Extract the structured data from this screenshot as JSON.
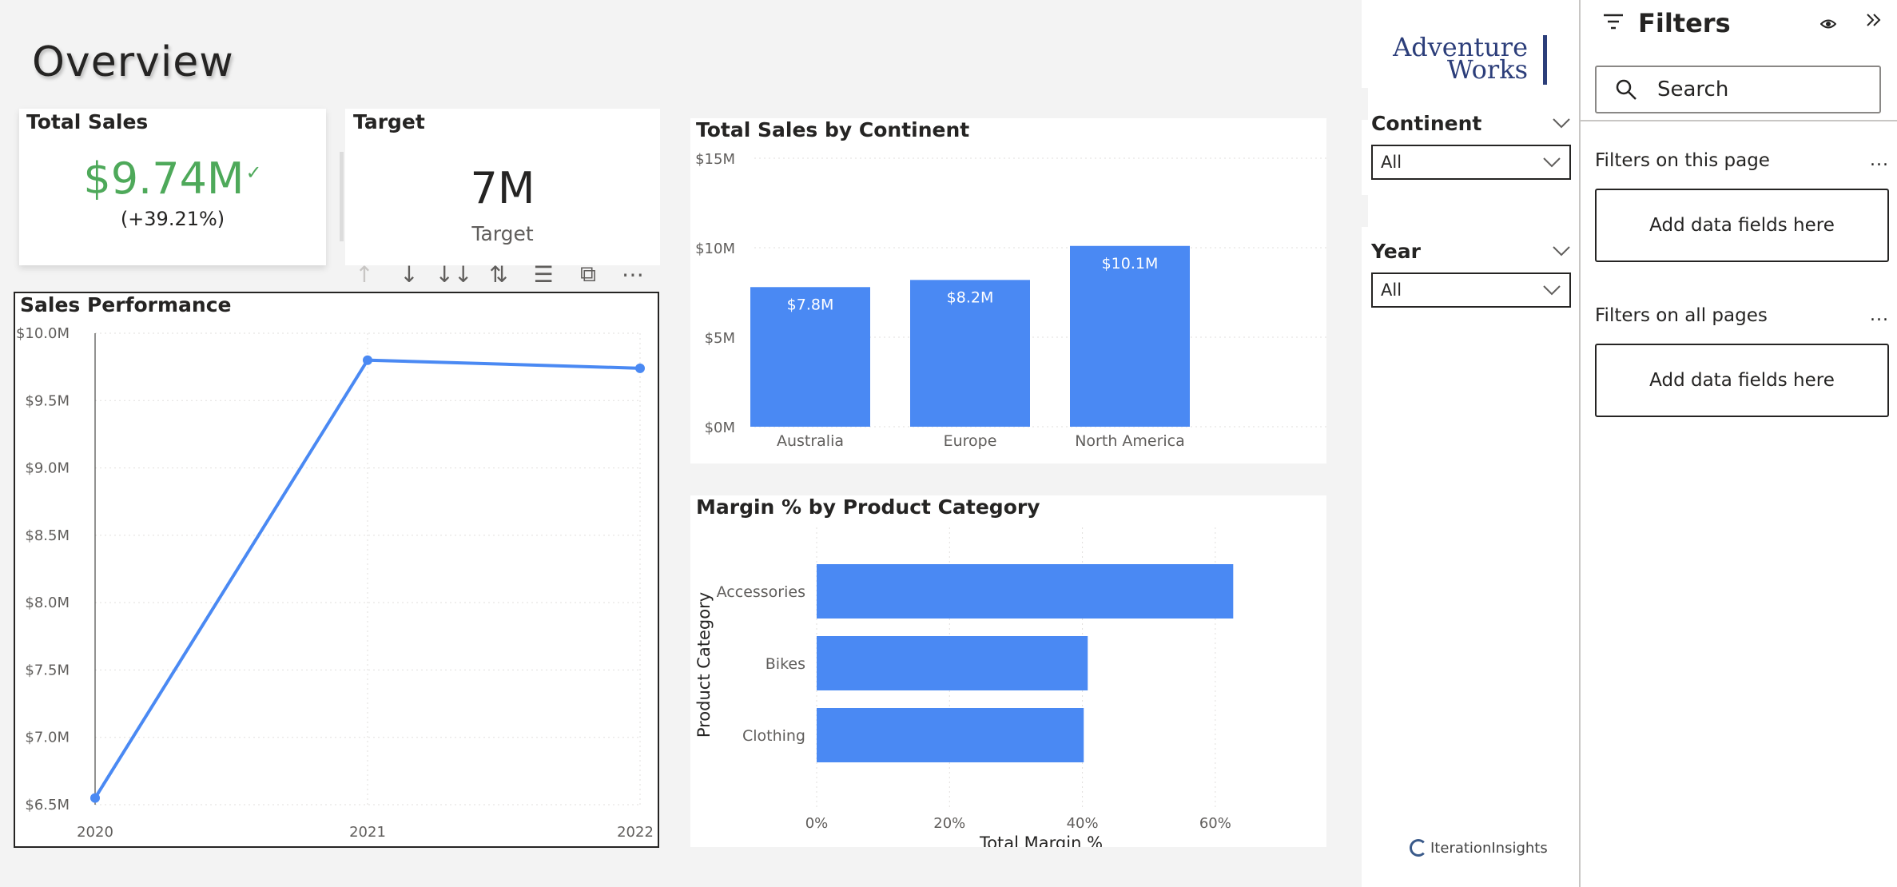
{
  "page": {
    "title": "Overview"
  },
  "kpi_sales": {
    "title": "Total Sales",
    "value": "$9.74M",
    "check": "✓",
    "delta": "(+39.21%)",
    "value_color": "#4ea95a"
  },
  "kpi_target": {
    "title": "Target",
    "value": "7M",
    "label": "Target"
  },
  "toolbar": {
    "items": [
      {
        "name": "drill-up-icon",
        "glyph": "↑"
      },
      {
        "name": "drill-down-icon",
        "glyph": "↓"
      },
      {
        "name": "next-level-icon",
        "glyph": "↓↓"
      },
      {
        "name": "expand-hierarchy-icon",
        "glyph": "⇅"
      },
      {
        "name": "filter-icon",
        "glyph": "☰"
      },
      {
        "name": "focus-mode-icon",
        "glyph": "⧉"
      },
      {
        "name": "more-options-icon",
        "glyph": "⋯"
      }
    ]
  },
  "accent_color": "#4a89f3",
  "chart_data": [
    {
      "type": "line",
      "title": "Sales Performance",
      "x": [
        "2020",
        "2021",
        "2022"
      ],
      "series": [
        {
          "values": [
            6.55,
            9.8,
            9.74
          ]
        }
      ],
      "y_ticks": [
        "$10.0M",
        "$9.5M",
        "$9.0M",
        "$8.5M",
        "$8.0M",
        "$7.5M",
        "$7.0M",
        "$6.5M"
      ],
      "ylim": [
        6.5,
        10.0
      ],
      "grid": true
    },
    {
      "type": "bar",
      "title": "Total Sales by Continent",
      "categories": [
        "Australia",
        "Europe",
        "North America"
      ],
      "values": [
        7.8,
        8.2,
        10.1
      ],
      "data_labels": [
        "$7.8M",
        "$8.2M",
        "$10.1M"
      ],
      "y_ticks": [
        "$15M",
        "$10M",
        "$5M",
        "$0M"
      ],
      "ylim": [
        0,
        15
      ],
      "grid": true
    },
    {
      "type": "bar",
      "orientation": "horizontal",
      "title": "Margin % by Product Category",
      "categories": [
        "Accessories",
        "Bikes",
        "Clothing"
      ],
      "values": [
        62.7,
        40.8,
        40.2
      ],
      "x_ticks": [
        "0%",
        "20%",
        "40%",
        "60%"
      ],
      "xlim": [
        0,
        70
      ],
      "xlabel": "Total Margin %",
      "ylabel": "Product Category",
      "grid": true
    }
  ],
  "logo": {
    "line1": "Adventure",
    "line2": "Works"
  },
  "slicers": [
    {
      "label": "Continent",
      "value": "All"
    },
    {
      "label": "Year",
      "value": "All"
    }
  ],
  "footer_logo": {
    "text": "IterationInsights"
  },
  "filters": {
    "title": "Filters",
    "search_placeholder": "Search",
    "sections": [
      {
        "label": "Filters on this page",
        "more": "...",
        "drop": "Add data fields here"
      },
      {
        "label": "Filters on all pages",
        "more": "...",
        "drop": "Add data fields here"
      }
    ]
  }
}
